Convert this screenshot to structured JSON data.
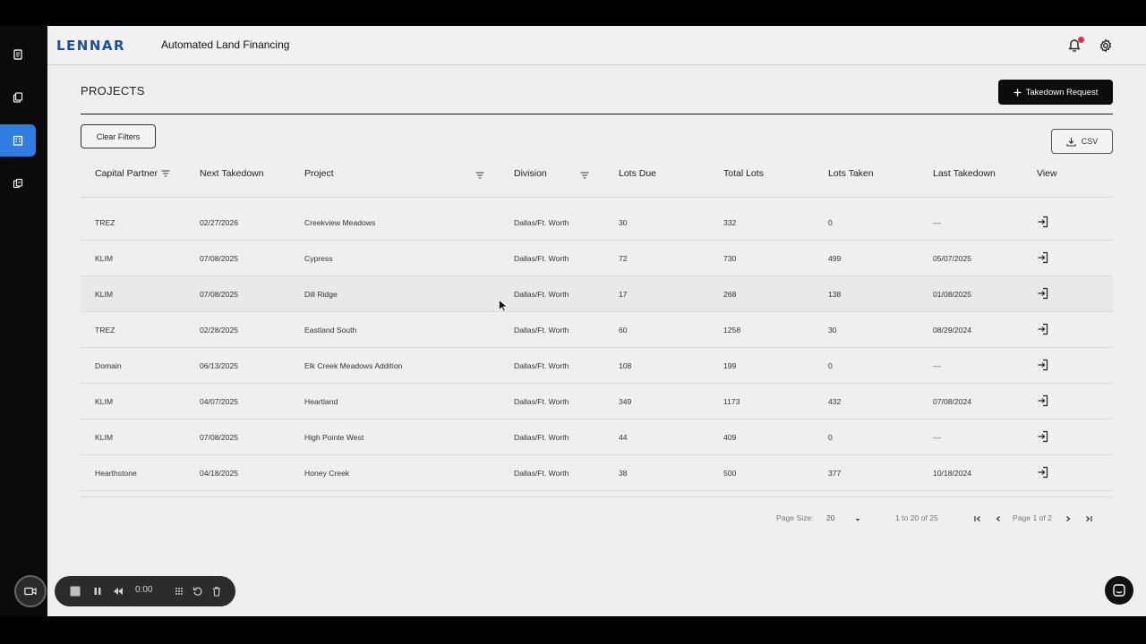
{
  "app": {
    "brand": "LENNAR",
    "title": "Automated Land Financing"
  },
  "page": {
    "title": "PROJECTS"
  },
  "actions": {
    "takedown_label": "Takedown Request",
    "clear_filters_label": "Clear Filters",
    "csv_label": "CSV"
  },
  "table": {
    "headers": {
      "capital_partner": "Capital Partner",
      "next_takedown": "Next Takedown",
      "project": "Project",
      "division": "Division",
      "lots_due": "Lots Due",
      "total_lots": "Total Lots",
      "lots_taken": "Lots Taken",
      "last_takedown": "Last Takedown",
      "view": "View"
    },
    "rows": [
      {
        "partner": "TREZ",
        "next": "02/27/2026",
        "project": "Creekview Meadows",
        "division": "Dallas/Ft. Worth",
        "due": "30",
        "total": "332",
        "taken": "0",
        "last": "---"
      },
      {
        "partner": "KLIM",
        "next": "07/08/2025",
        "project": "Cypress",
        "division": "Dallas/Ft. Worth",
        "due": "72",
        "total": "730",
        "taken": "499",
        "last": "05/07/2025"
      },
      {
        "partner": "KLIM",
        "next": "07/08/2025",
        "project": "Dill Ridge",
        "division": "Dallas/Ft. Worth",
        "due": "17",
        "total": "268",
        "taken": "138",
        "last": "01/08/2025"
      },
      {
        "partner": "TREZ",
        "next": "02/28/2025",
        "project": "Eastland South",
        "division": "Dallas/Ft. Worth",
        "due": "60",
        "total": "1258",
        "taken": "30",
        "last": "08/29/2024"
      },
      {
        "partner": "Domain",
        "next": "06/13/2025",
        "project": "Elk Creek Meadows Addition",
        "division": "Dallas/Ft. Worth",
        "due": "108",
        "total": "199",
        "taken": "0",
        "last": "---"
      },
      {
        "partner": "KLIM",
        "next": "04/07/2025",
        "project": "Heartland",
        "division": "Dallas/Ft. Worth",
        "due": "349",
        "total": "1173",
        "taken": "432",
        "last": "07/08/2024"
      },
      {
        "partner": "KLIM",
        "next": "07/08/2025",
        "project": "High Pointe West",
        "division": "Dallas/Ft. Worth",
        "due": "44",
        "total": "409",
        "taken": "0",
        "last": "---"
      },
      {
        "partner": "Hearthstone",
        "next": "04/18/2025",
        "project": "Honey Creek",
        "division": "Dallas/Ft. Worth",
        "due": "38",
        "total": "500",
        "taken": "377",
        "last": "10/18/2024"
      }
    ]
  },
  "pagination": {
    "page_size_label": "Page Size:",
    "page_size": "20",
    "range": "1 to 20 of 25",
    "page": "Page 1 of 2"
  },
  "recorder": {
    "time": "0:00"
  },
  "icons": [
    "doc-icon",
    "copy-icon",
    "building-icon",
    "swap-icon",
    "bell-icon",
    "gear-icon",
    "plus-icon",
    "download-icon",
    "filter-icon",
    "login-icon",
    "chat-icon"
  ],
  "colors": {
    "brand": "#1f4e9a",
    "active_nav": "#2f7de1",
    "notification": "#e0314b"
  }
}
